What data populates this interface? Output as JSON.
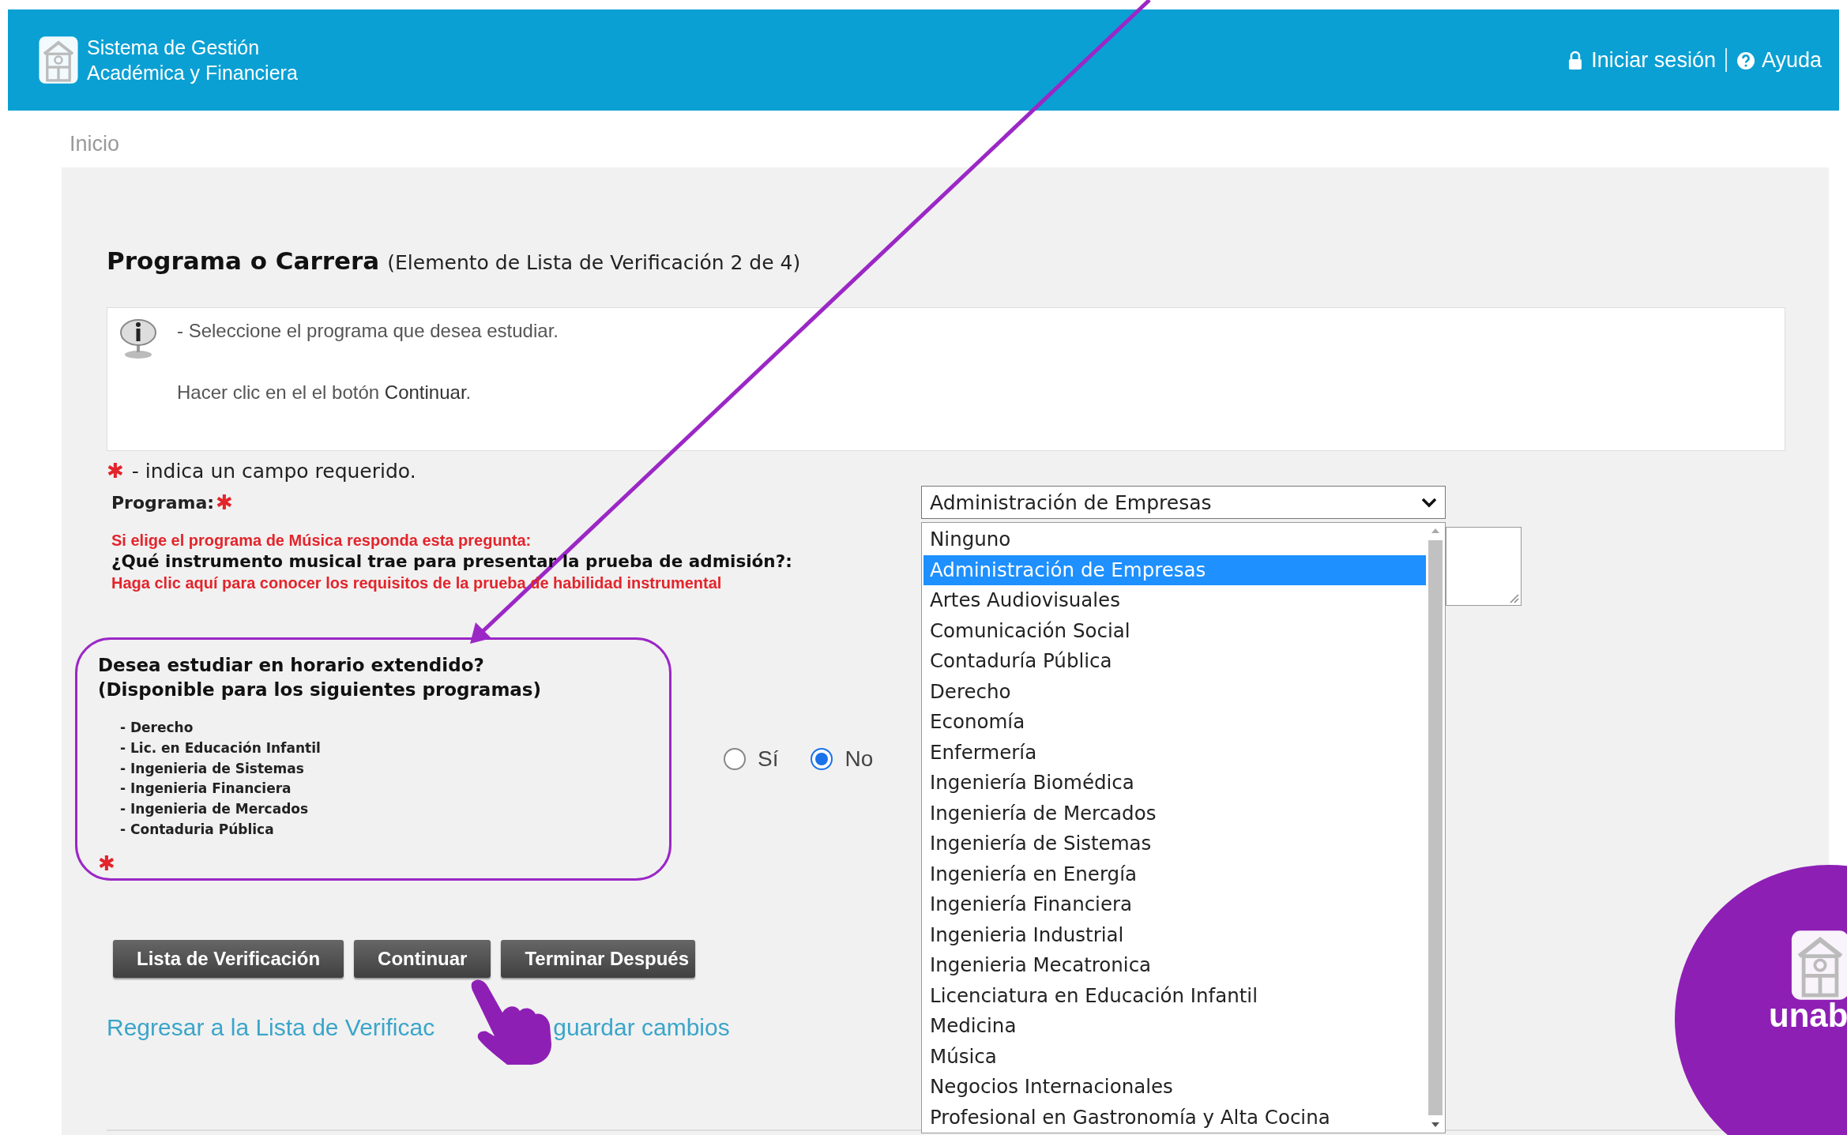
{
  "header": {
    "title_lines": [
      "Sistema de Gestión",
      "Académica y Financiera"
    ],
    "links": [
      {
        "kind": "lock",
        "label": "Iniciar sesión"
      },
      {
        "kind": "help",
        "label": "Ayuda"
      }
    ]
  },
  "breadcrumb": "Inicio",
  "page": {
    "title": "Programa o Carrera",
    "subtitle": "(Elemento de Lista de Verificación 2 de 4)"
  },
  "info": {
    "lines": [
      "- Seleccione el programa que desea estudiar.",
      "Hacer clic en el el botón **Continuar**."
    ]
  },
  "required_note": {
    "mark": "✱",
    "text": "- indica un campo requerido."
  },
  "program": {
    "label": "Programa:",
    "required_mark": "✱",
    "value": "Administración de Empresas",
    "expanded": true,
    "options": [
      {
        "label": "Ninguno",
        "selected": false
      },
      {
        "label": "Administración de Empresas",
        "selected": true
      },
      {
        "label": "Artes Audiovisuales",
        "selected": false
      },
      {
        "label": "Comunicación Social",
        "selected": false
      },
      {
        "label": "Contaduría Pública",
        "selected": false
      },
      {
        "label": "Derecho",
        "selected": false
      },
      {
        "label": "Economía",
        "selected": false
      },
      {
        "label": "Enfermería",
        "selected": false
      },
      {
        "label": "Ingeniería Biomédica",
        "selected": false
      },
      {
        "label": "Ingeniería de Mercados",
        "selected": false
      },
      {
        "label": "Ingeniería de Sistemas",
        "selected": false
      },
      {
        "label": "Ingeniería en Energía",
        "selected": false
      },
      {
        "label": "Ingeniería Financiera",
        "selected": false
      },
      {
        "label": "Ingenieria Industrial",
        "selected": false
      },
      {
        "label": "Ingenieria Mecatronica",
        "selected": false
      },
      {
        "label": "Licenciatura en Educación Infantil",
        "selected": false
      },
      {
        "label": "Medicina",
        "selected": false
      },
      {
        "label": "Música",
        "selected": false
      },
      {
        "label": "Negocios Internacionales",
        "selected": false
      },
      {
        "label": "Profesional en Gastronomía y Alta Cocina",
        "selected": false
      }
    ]
  },
  "music": {
    "note": "Si elige el programa de Música responda esta pregunta:",
    "question": "¿Qué instrumento musical trae para presentar la prueba de admisión?:",
    "link": "Haga clic aquí para conocer los requisitos de la prueba de habilidad instrumental"
  },
  "extended": {
    "question_lines": [
      "Desea estudiar en horario extendido?",
      "(Disponible para los siguientes programas)"
    ],
    "programs": [
      "- Derecho",
      "- Lic. en Educación Infantil",
      "- Ingenieria de Sistemas",
      "- Ingenieria Financiera",
      "- Ingenieria de Mercados",
      "- Contaduria Pública"
    ],
    "required_mark": "✱",
    "options": [
      {
        "label": "Sí",
        "selected": false
      },
      {
        "label": "No",
        "selected": true
      }
    ]
  },
  "buttons": [
    "Lista de Verificación",
    "Continuar",
    "Terminar Después"
  ],
  "back_link": [
    "Regresar a la Lista de Verificac",
    "guardar cambios"
  ],
  "badge": {
    "text": "unab"
  }
}
